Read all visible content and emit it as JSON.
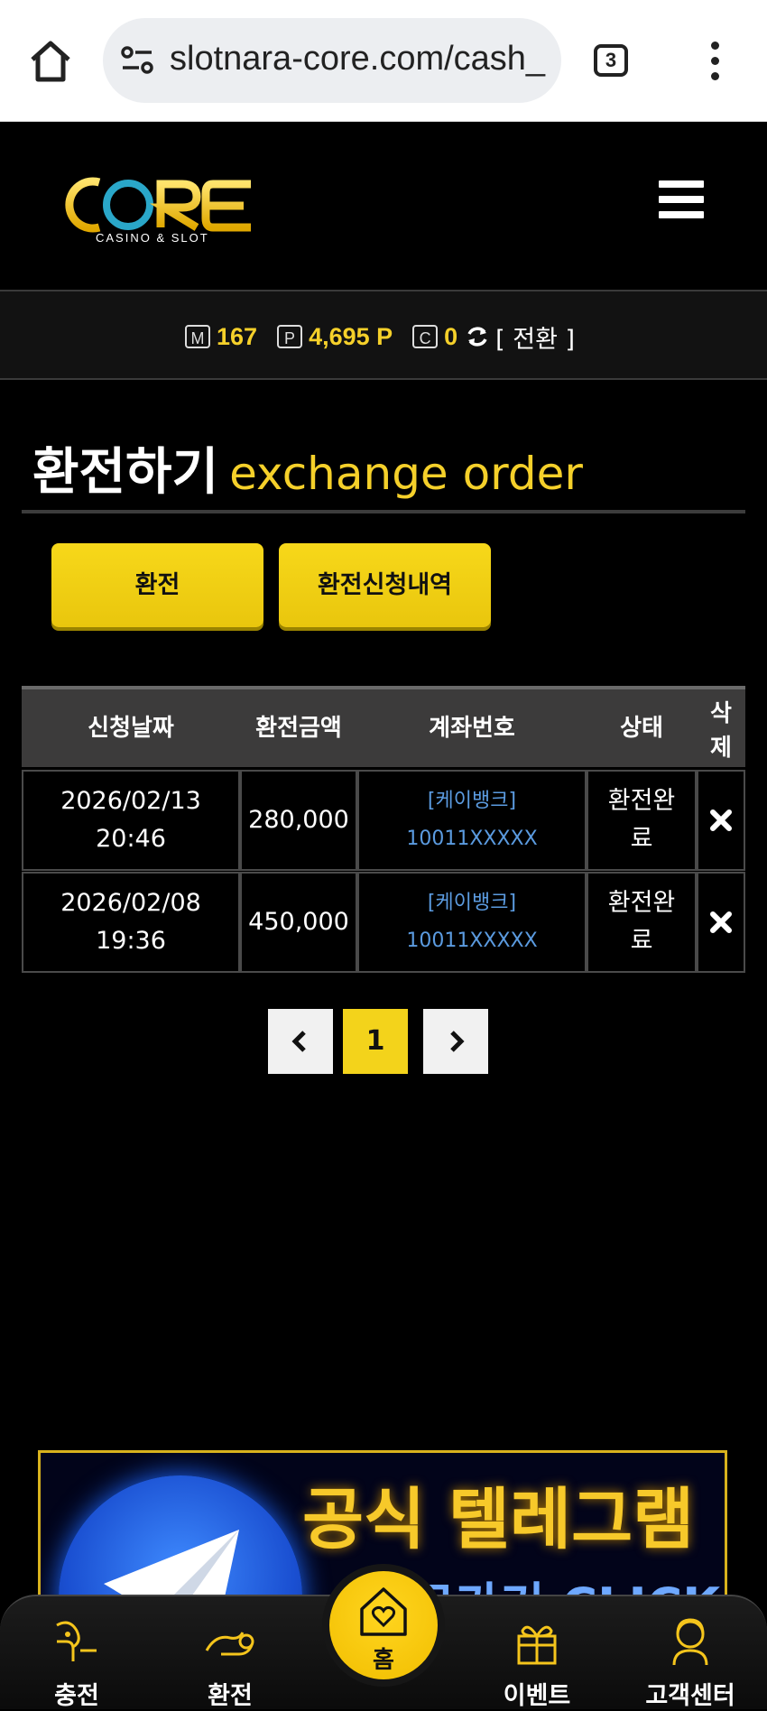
{
  "browser": {
    "url": "slotnara-core.com/cash_",
    "tab_count": "3"
  },
  "header": {
    "logo_text": "CORE",
    "logo_sub": "CASINO & SLOT"
  },
  "balance": {
    "m_badge": "M",
    "m_value": "167",
    "p_badge": "P",
    "p_value": "4,695 P",
    "c_badge": "C",
    "c_value": "0",
    "convert_label": "[ 전환 ]"
  },
  "page": {
    "title_ko": "환전하기",
    "title_en": "exchange order",
    "btn_exchange": "환전",
    "btn_history": "환전신청내역"
  },
  "table": {
    "headers": {
      "date": "신청날짜",
      "amount": "환전금액",
      "account": "계좌번호",
      "status": "상태",
      "delete_1": "삭",
      "delete_2": "제"
    },
    "rows": [
      {
        "date": "2026/02/13",
        "time": "20:46",
        "amount": "280,000",
        "bank": "[케이뱅크]",
        "account": "10011XXXXX",
        "status_1": "환전완",
        "status_2": "료"
      },
      {
        "date": "2026/02/08",
        "time": "19:36",
        "amount": "450,000",
        "bank": "[케이뱅크]",
        "account": "10011XXXXX",
        "status_1": "환전완",
        "status_2": "료"
      }
    ]
  },
  "pagination": {
    "current": "1"
  },
  "banner": {
    "title": "공식 텔레그램",
    "sub": "바로가기 CLICK"
  },
  "bottom_nav": {
    "charge": "충전",
    "exchange": "환전",
    "home": "홈",
    "event": "이벤트",
    "support": "고객센터"
  },
  "colors": {
    "accent": "#f5d02a",
    "link": "#5b9be0",
    "background": "#000000"
  }
}
